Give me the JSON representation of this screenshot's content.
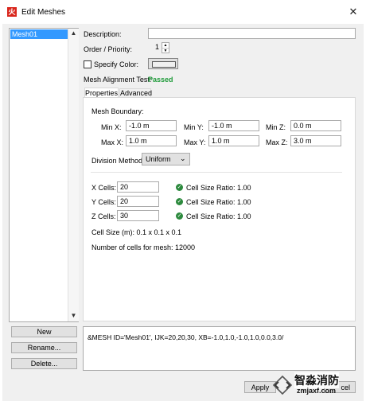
{
  "window": {
    "title": "Edit Meshes",
    "icon_letter": "火",
    "close_glyph": "✕"
  },
  "mesh_list": {
    "items": [
      "Mesh01"
    ],
    "scroll_up": "▲",
    "scroll_down": "▼"
  },
  "left_buttons": {
    "new": "New",
    "rename": "Rename...",
    "delete": "Delete..."
  },
  "form": {
    "description_label": "Description:",
    "description_value": "",
    "order_label": "Order / Priority:",
    "order_value": "1",
    "specify_color_label": "Specify Color:",
    "specify_color_checked": false,
    "alignment_label": "Mesh Alignment Test:",
    "alignment_status": "Passed",
    "alignment_status_color": "#1f9b3a"
  },
  "tabs": [
    {
      "label": "Properties",
      "active": true
    },
    {
      "label": "Advanced",
      "active": false
    }
  ],
  "properties": {
    "boundary_label": "Mesh Boundary:",
    "min_x_label": "Min X:",
    "min_x": "-1.0 m",
    "min_y_label": "Min Y:",
    "min_y": "-1.0 m",
    "min_z_label": "Min Z:",
    "min_z": "0.0 m",
    "max_x_label": "Max X:",
    "max_x": "1.0 m",
    "max_y_label": "Max Y:",
    "max_y": "1.0 m",
    "max_z_label": "Max Z:",
    "max_z": "3.0 m",
    "division_label": "Division Method:",
    "division_value": "Uniform",
    "cells": [
      {
        "label": "X Cells:",
        "value": "20",
        "ratio": "Cell Size Ratio: 1.00"
      },
      {
        "label": "Y Cells:",
        "value": "20",
        "ratio": "Cell Size Ratio: 1.00"
      },
      {
        "label": "Z Cells:",
        "value": "30",
        "ratio": "Cell Size Ratio: 1.00"
      }
    ],
    "cell_size": "Cell Size (m): 0.1 x 0.1 x 0.1",
    "num_cells": "Number of cells for mesh: 12000"
  },
  "output_text": "&MESH ID='Mesh01', IJK=20,20,30, XB=-1.0,1.0,-1.0,1.0,0.0,3.0/",
  "bottom_buttons": {
    "apply": "Apply",
    "cancel_partial": "cel"
  },
  "watermark": {
    "text": "智淼消防",
    "url": "zmjaxf.com"
  },
  "colors": {
    "selection": "#3399ff",
    "brand_red": "#d9261c",
    "ok_green": "#2d8a3e"
  }
}
